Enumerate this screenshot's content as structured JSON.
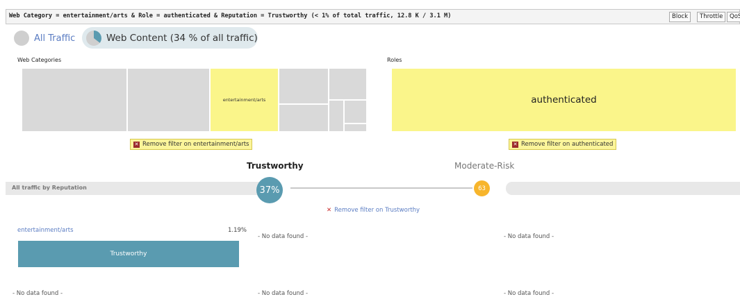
{
  "filter_bar": {
    "summary": "Web Category = entertainment/arts & Role = authenticated & Reputation = Trustworthy (< 1% of total traffic, 12.8 K / 3.1 M)",
    "buttons": [
      "Block",
      "Throttle",
      "QoS"
    ]
  },
  "breadcrumbs": {
    "all": "All Traffic",
    "current": "Web Content (34 % of all traffic)"
  },
  "web_categories": {
    "title": "Web Categories",
    "highlighted": "entertainment/arts",
    "remove_filter": "Remove filter on entertainment/arts"
  },
  "roles": {
    "title": "Roles",
    "highlighted": "authenticated",
    "remove_filter": "Remove filter on authenticated"
  },
  "reputation": {
    "row_label": "All traffic by Reputation",
    "selected_title": "Trustworthy",
    "selected_value": "37%",
    "other_title": "Moderate-Risk",
    "other_value": "63",
    "remove_filter": "Remove filter on Trustworthy"
  },
  "results": {
    "category_link": "entertainment/arts",
    "percent": "1.19%",
    "bar_label": "Trustworthy",
    "no_data": "- No data found -"
  },
  "colors": {
    "highlight_yellow": "#faf58a",
    "trustworthy_teal": "#5a9bb0",
    "moderate_orange": "#f7b52c",
    "link_blue": "#5a7cc2"
  },
  "icons": [
    "pie-partial-icon",
    "remove-x-icon"
  ]
}
